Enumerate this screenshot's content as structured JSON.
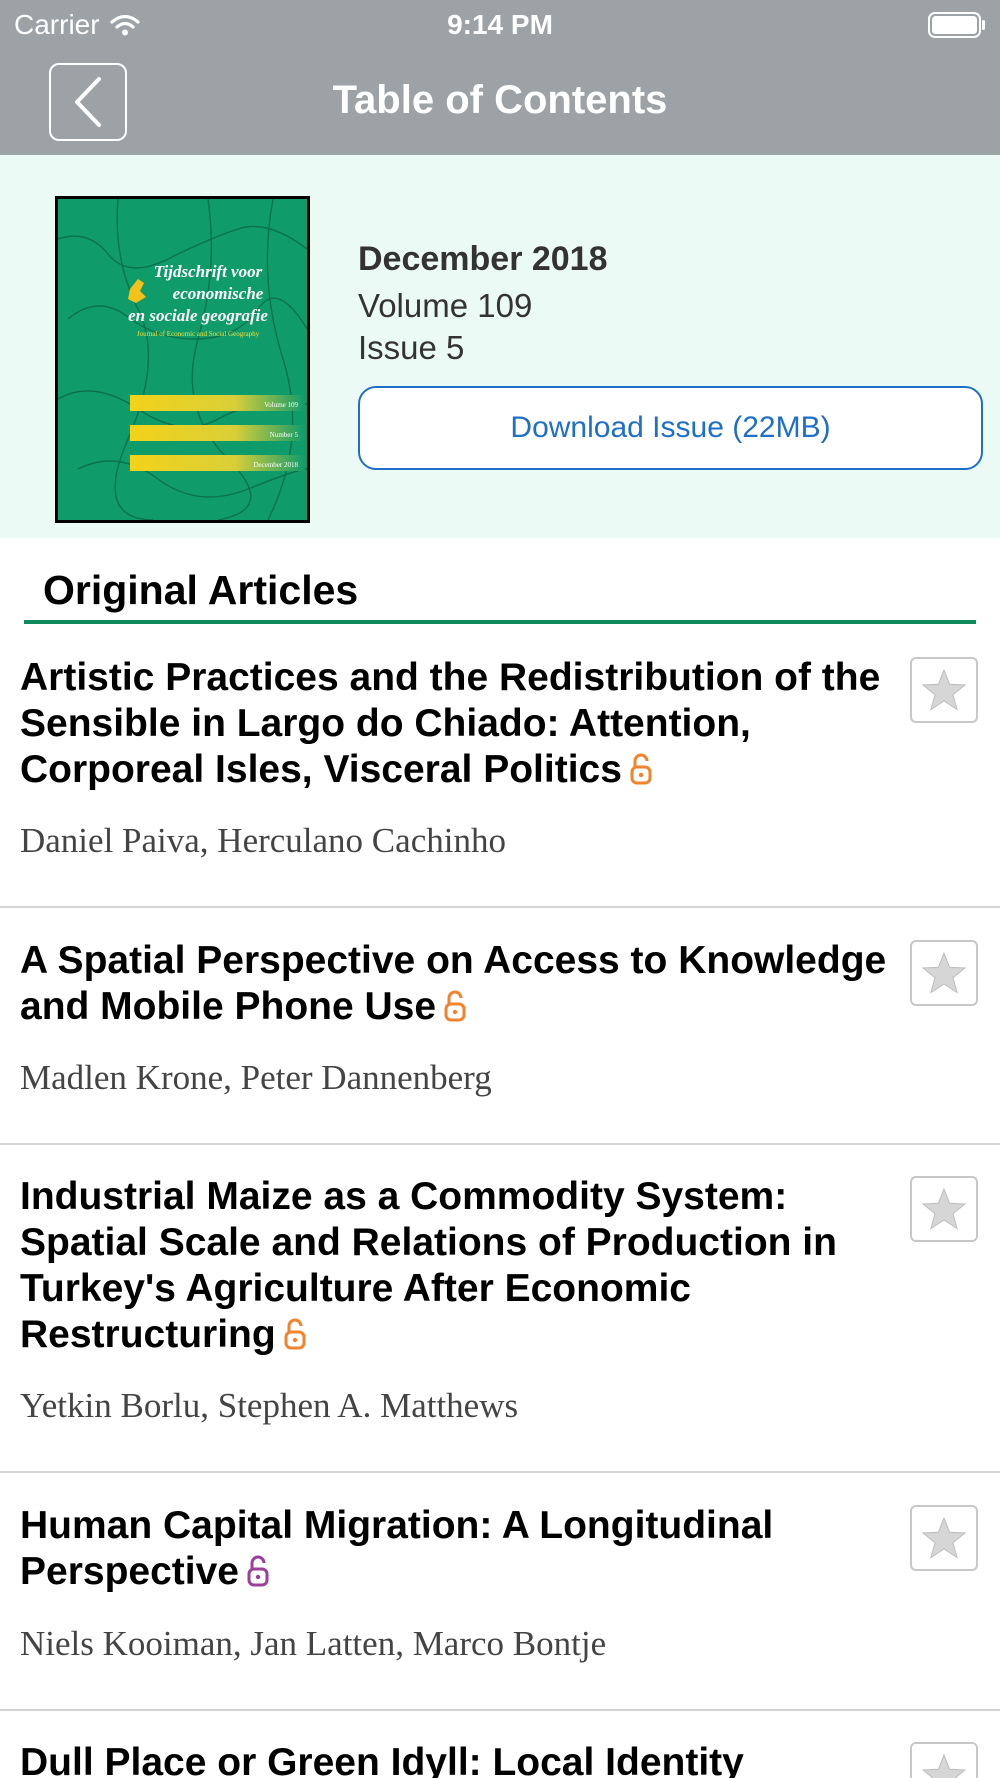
{
  "status_bar": {
    "carrier": "Carrier",
    "time": "9:14 PM"
  },
  "nav": {
    "title": "Table of Contents",
    "back_icon": "chevron-left-icon"
  },
  "issue": {
    "date": "December 2018",
    "volume": "Volume 109",
    "number": "Issue 5",
    "download_label": "Download Issue (22MB)",
    "cover_title_lines": [
      "Tijdschrift voor",
      "economische",
      "en sociale geografie"
    ],
    "cover_subtitle": "Journal of Economic and Social Geography",
    "cover_labels": [
      "Volume 109",
      "Number 5",
      "December 2018"
    ]
  },
  "section": {
    "title": "Original Articles"
  },
  "articles": [
    {
      "title": "Artistic Practices and the Redistribution of the Sensible in Largo do Chiado: Attention, Corporeal Isles, Visceral Politics",
      "authors": "Daniel Paiva, Herculano Cachinho",
      "access_icon": "open-access-lock-icon",
      "access_color": "#f0842c"
    },
    {
      "title": "A Spatial Perspective on Access to Knowledge and Mobile Phone Use",
      "authors": "Madlen Krone, Peter Dannenberg",
      "access_icon": "open-access-lock-icon",
      "access_color": "#f0842c"
    },
    {
      "title": "Industrial Maize as a Commodity System: Spatial Scale and Relations of Production in Turkey's Agriculture After Economic Restructuring",
      "authors": "Yetkin Borlu, Stephen A. Matthews",
      "access_icon": "open-access-lock-icon",
      "access_color": "#f0842c"
    },
    {
      "title": "Human Capital Migration: A Longitudinal Perspective",
      "authors": "Niels Kooiman, Jan Latten, Marco Bontje",
      "access_icon": "open-access-lock-icon",
      "access_color": "#9b3f9a"
    },
    {
      "title": "Dull Place or Green Idyll: Local Identity",
      "authors": "",
      "access_icon": "",
      "access_color": ""
    }
  ],
  "colors": {
    "nav_bg": "#9da2a6",
    "header_bg": "#ecfaf6",
    "accent_blue": "#1e6fc8",
    "section_rule": "#0f8a5c"
  }
}
